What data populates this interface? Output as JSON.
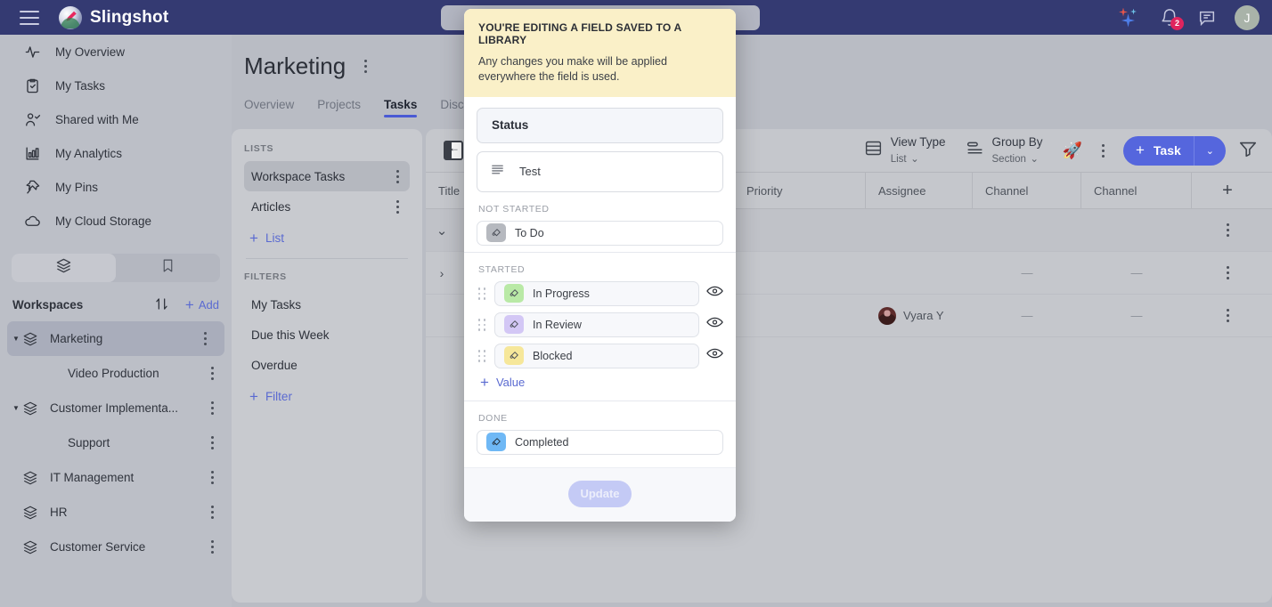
{
  "topbar": {
    "brand": "Slingshot",
    "menu_icon": "hamburger-icon",
    "search_placeholder": "",
    "notification_count": "2",
    "avatar_initial": "J"
  },
  "sidebar": {
    "nav": [
      {
        "label": "My Overview",
        "icon": "activity-icon"
      },
      {
        "label": "My Tasks",
        "icon": "clipboard-check-icon"
      },
      {
        "label": "Shared with Me",
        "icon": "person-check-icon"
      },
      {
        "label": "My Analytics",
        "icon": "bar-chart-icon"
      },
      {
        "label": "My Pins",
        "icon": "pin-icon"
      },
      {
        "label": "My Cloud Storage",
        "icon": "cloud-icon"
      }
    ],
    "workspaces_title": "Workspaces",
    "add_label": "Add",
    "workspaces": [
      {
        "label": "Marketing",
        "level": 0,
        "expanded": true,
        "selected": true
      },
      {
        "label": "Video Production",
        "level": 1,
        "expanded": false,
        "selected": false
      },
      {
        "label": "Customer Implementa...",
        "level": 0,
        "expanded": true,
        "selected": false
      },
      {
        "label": "Support",
        "level": 1,
        "expanded": false,
        "selected": false
      },
      {
        "label": "IT Management",
        "level": 0,
        "expanded": false,
        "selected": false
      },
      {
        "label": "HR",
        "level": 0,
        "expanded": false,
        "selected": false
      },
      {
        "label": "Customer Service",
        "level": 0,
        "expanded": false,
        "selected": false
      }
    ]
  },
  "main": {
    "page_title": "Marketing",
    "tabs": [
      {
        "label": "Overview",
        "active": false
      },
      {
        "label": "Projects",
        "active": false
      },
      {
        "label": "Tasks",
        "active": true
      },
      {
        "label": "Discussio",
        "active": false
      }
    ],
    "lists_panel": {
      "lists_header": "LISTS",
      "lists": [
        {
          "label": "Workspace Tasks",
          "active": true
        },
        {
          "label": "Articles",
          "active": false
        }
      ],
      "add_list_label": "List",
      "filters_header": "FILTERS",
      "filters": [
        {
          "label": "My Tasks"
        },
        {
          "label": "Due this Week"
        },
        {
          "label": "Overdue"
        }
      ],
      "add_filter_label": "Filter"
    },
    "toolbar": {
      "view_type_label": "View Type",
      "view_type_value": "List",
      "group_by_label": "Group By",
      "group_by_value": "Section",
      "rocket_icon": "rocket-icon",
      "task_button_label": "Task",
      "filter_icon": "filter-icon"
    },
    "table": {
      "columns": [
        "Title",
        "Priority",
        "Assignee",
        "Channel",
        "Channel"
      ],
      "add_column_label": "+",
      "rows": [
        {
          "expander": "chevron-down",
          "priority": "",
          "assignee": "",
          "channel1": "",
          "channel2": ""
        },
        {
          "expander": "chevron-right",
          "priority": "",
          "assignee": "",
          "channel1": "—",
          "channel2": "—"
        },
        {
          "expander": "",
          "priority": "",
          "assignee": "Vyara Y",
          "channel1": "—",
          "channel2": "—"
        }
      ]
    }
  },
  "modal": {
    "banner_title": "YOU'RE EDITING A FIELD SAVED TO A LIBRARY",
    "banner_body": "Any changes you make will be applied everywhere the field is used.",
    "field_name": "Status",
    "description_value": "Test",
    "groups": [
      {
        "label": "NOT STARTED",
        "draggable": false,
        "has_eye": false,
        "values": [
          {
            "label": "To Do",
            "color": "#b6b9bf"
          }
        ]
      },
      {
        "label": "STARTED",
        "draggable": true,
        "has_eye": true,
        "values": [
          {
            "label": "In Progress",
            "color": "#b9e9a6"
          },
          {
            "label": "In Review",
            "color": "#d3c7f5"
          },
          {
            "label": "Blocked",
            "color": "#f6e79a"
          }
        ],
        "add_value_label": "Value"
      },
      {
        "label": "DONE",
        "draggable": false,
        "has_eye": false,
        "values": [
          {
            "label": "Completed",
            "color": "#6fb8f5"
          }
        ]
      }
    ],
    "update_label": "Update"
  },
  "colors": {
    "navbar": "#343a72",
    "accent": "#5566dd",
    "link": "#5a6ad1",
    "banner_bg": "#faf0c8",
    "page_bg": "#b9bcc4"
  }
}
